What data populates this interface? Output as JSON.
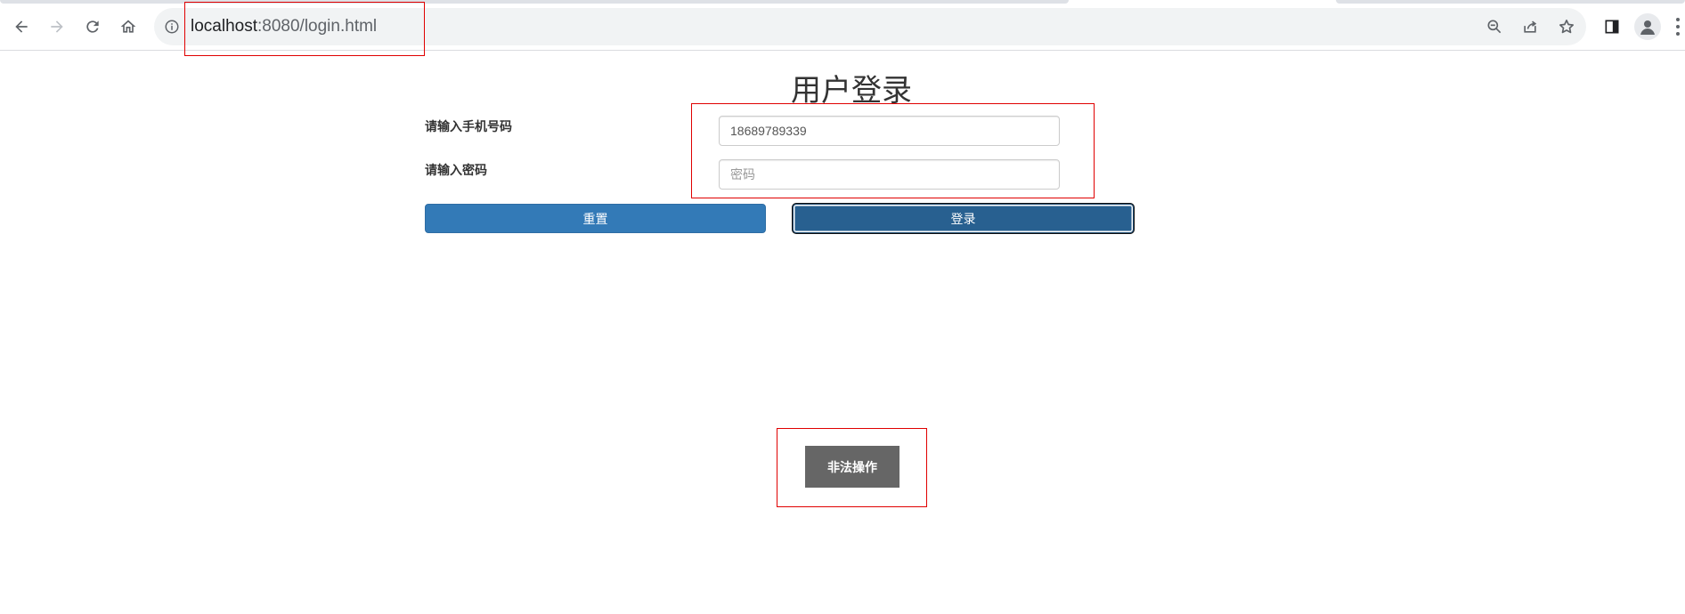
{
  "browser": {
    "url_host": "localhost",
    "url_rest": ":8080/login.html",
    "icons": [
      "back-icon",
      "forward-icon",
      "reload-icon",
      "home-icon",
      "info-icon",
      "zoom-out-icon",
      "share-icon",
      "star-icon",
      "side-panel-icon",
      "profile-icon",
      "menu-icon"
    ]
  },
  "page": {
    "title": "用户登录",
    "phone_label": "请输入手机号码",
    "phone_value": "18689789339",
    "password_label": "请输入密码",
    "password_placeholder": "密码",
    "reset_button": "重置",
    "login_button": "登录",
    "illegal_button": "非法操作"
  },
  "colors": {
    "primary": "#337ab7",
    "primary_active": "#286090",
    "illegal_button": "#666666",
    "annotation": "#e00000"
  }
}
